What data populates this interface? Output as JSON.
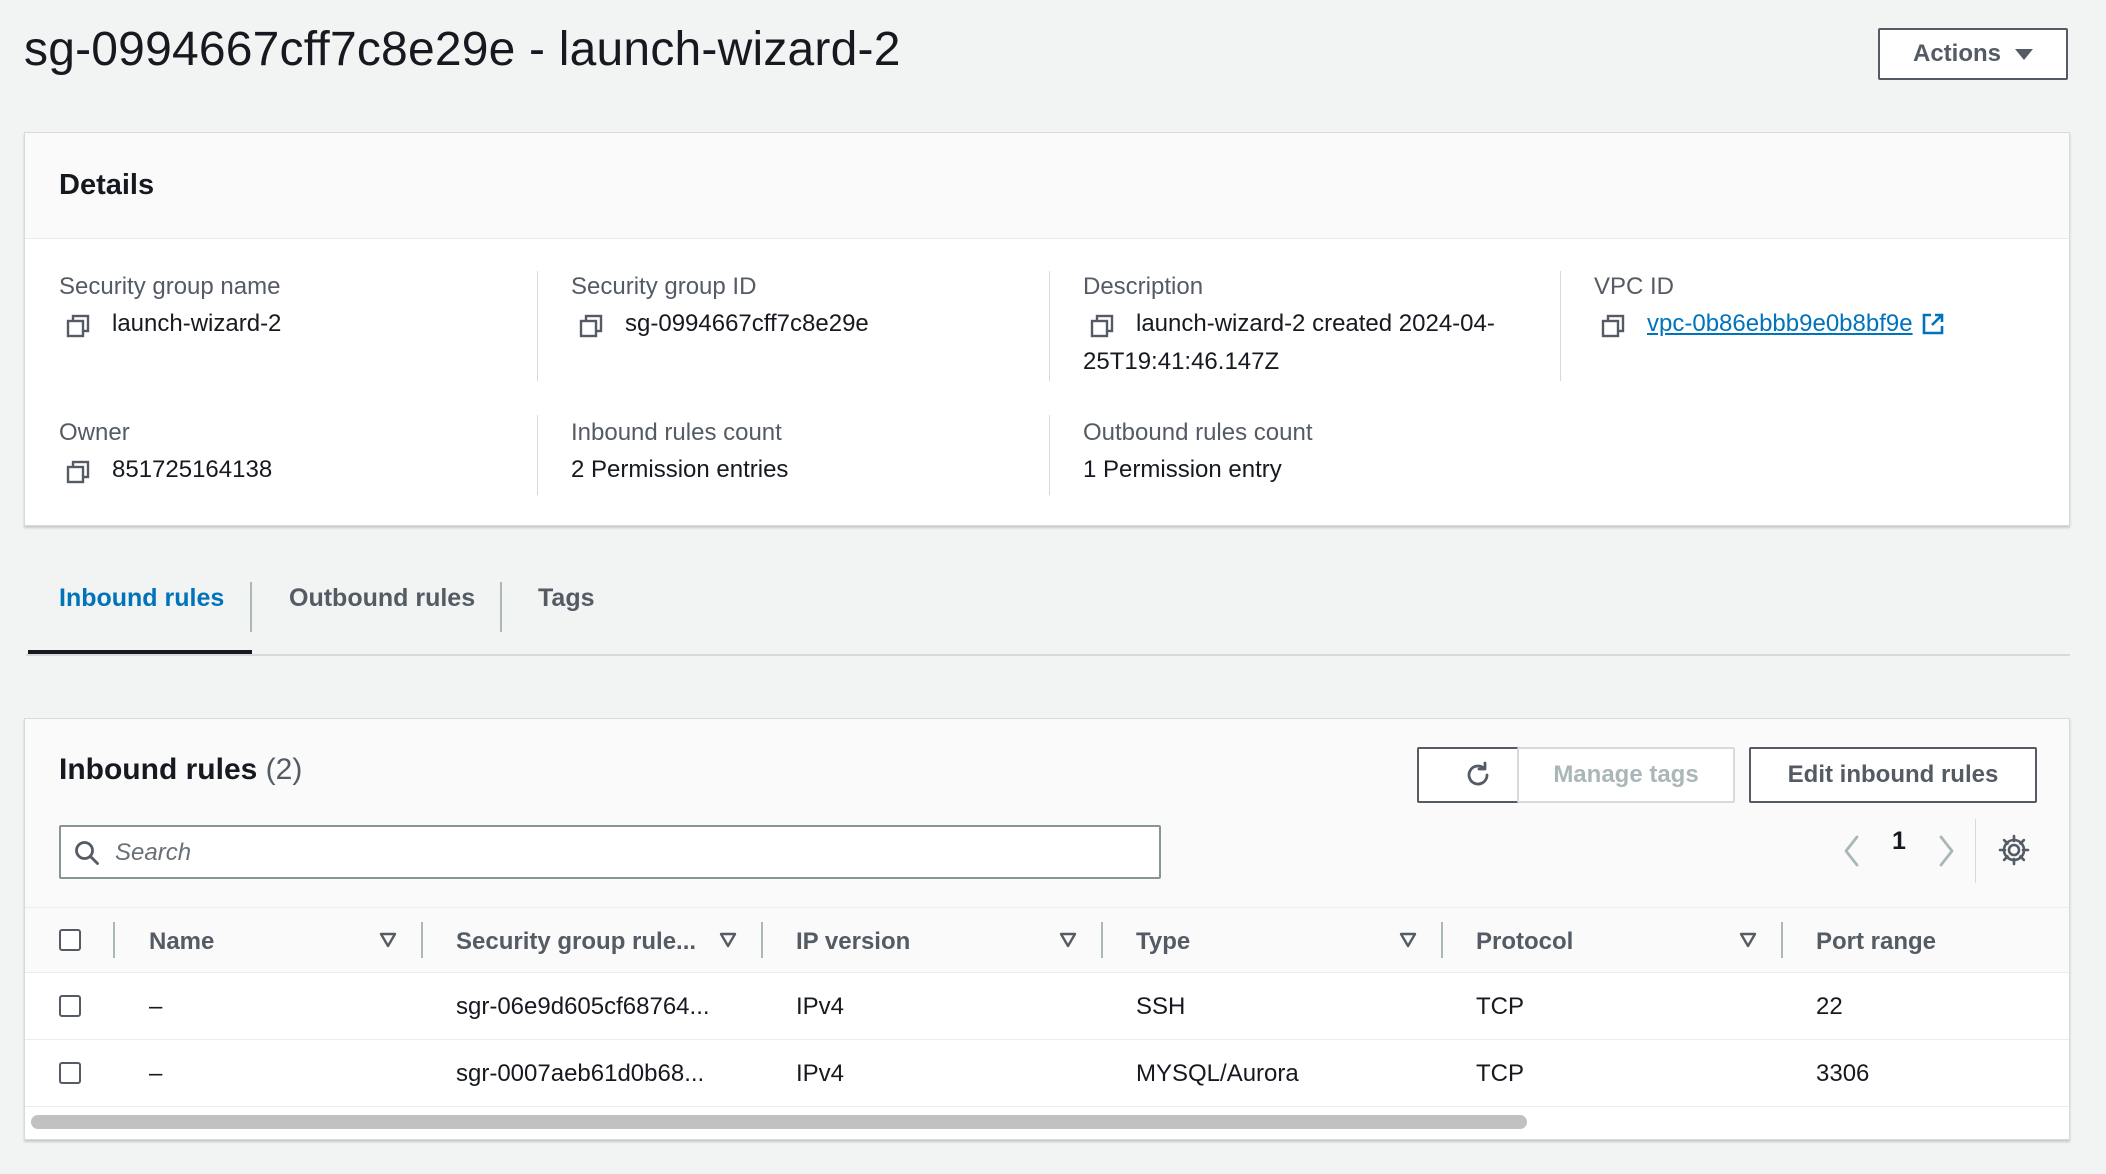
{
  "header": {
    "title": "sg-0994667cff7c8e29e - launch-wizard-2",
    "actions_label": "Actions"
  },
  "details": {
    "title": "Details",
    "fields": {
      "sg_name_label": "Security group name",
      "sg_name_value": "launch-wizard-2",
      "sg_id_label": "Security group ID",
      "sg_id_value": "sg-0994667cff7c8e29e",
      "description_label": "Description",
      "description_value_line1": "launch-wizard-2 created 2024-04-",
      "description_value_line2": "25T19:41:46.147Z",
      "vpc_id_label": "VPC ID",
      "vpc_id_value": "vpc-0b86ebbb9e0b8bf9e",
      "owner_label": "Owner",
      "owner_value": "851725164138",
      "inbound_count_label": "Inbound rules count",
      "inbound_count_value": "2 Permission entries",
      "outbound_count_label": "Outbound rules count",
      "outbound_count_value": "1 Permission entry"
    }
  },
  "tabs": [
    {
      "label": "Inbound rules",
      "active": true
    },
    {
      "label": "Outbound rules",
      "active": false
    },
    {
      "label": "Tags",
      "active": false
    }
  ],
  "inbound_table": {
    "title": "Inbound rules",
    "count": "(2)",
    "buttons": {
      "refresh_icon": "refresh-icon",
      "manage_tags": "Manage tags",
      "edit_inbound": "Edit inbound rules"
    },
    "search": {
      "placeholder": "Search",
      "value": ""
    },
    "pagination": {
      "current_page": "1"
    },
    "columns": [
      "Name",
      "Security group rule...",
      "IP version",
      "Type",
      "Protocol",
      "Port range"
    ],
    "rows": [
      {
        "name": "–",
        "rule_id": "sgr-06e9d605cf68764...",
        "ip_version": "IPv4",
        "type": "SSH",
        "protocol": "TCP",
        "port_range": "22"
      },
      {
        "name": "–",
        "rule_id": "sgr-0007aeb61d0b68...",
        "ip_version": "IPv4",
        "type": "MYSQL/Aurora",
        "protocol": "TCP",
        "port_range": "3306"
      }
    ]
  },
  "colors": {
    "background": "#f2f3f3",
    "link": "#0073bb",
    "text": "#16191f",
    "secondary_text": "#545b64"
  }
}
